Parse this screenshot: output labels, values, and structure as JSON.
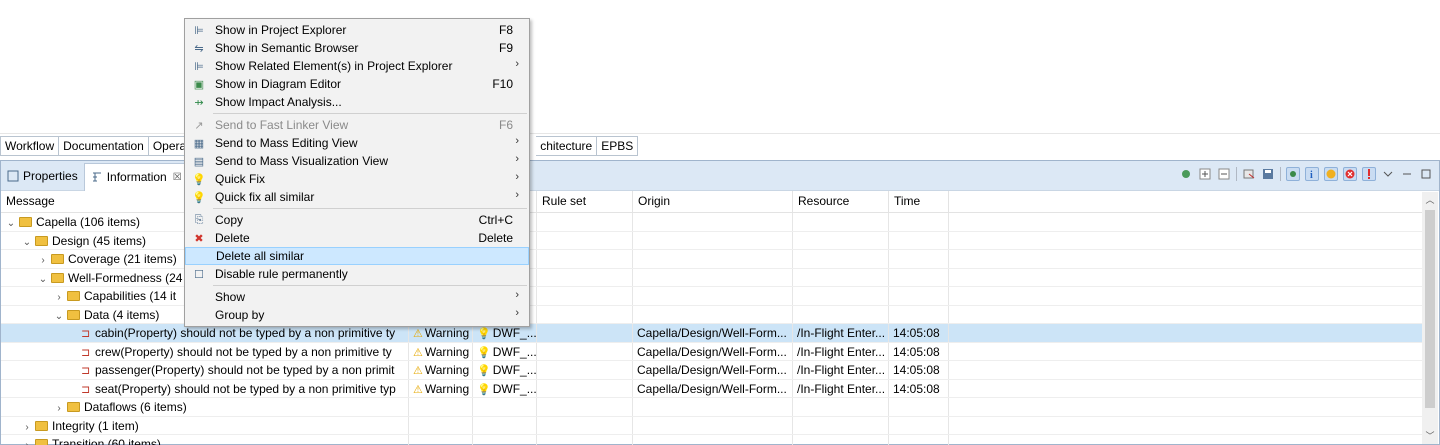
{
  "tabbar": {
    "tabs": [
      "Workflow",
      "Documentation",
      "Opera",
      "chitecture",
      "EPBS"
    ]
  },
  "view": {
    "tabs": [
      {
        "label": "Properties"
      },
      {
        "label": "Information"
      }
    ],
    "close_glyph": "☒"
  },
  "table": {
    "headers": [
      "Message",
      "",
      "",
      "Rule set",
      "Origin",
      "Resource",
      "Time"
    ],
    "rows": [
      {
        "indent": 0,
        "twisty": "v",
        "kind": "folder",
        "message": "Capella (106 items)"
      },
      {
        "indent": 1,
        "twisty": "v",
        "kind": "folder",
        "message": "Design (45 items)"
      },
      {
        "indent": 2,
        "twisty": ">",
        "kind": "folder",
        "message": "Coverage (21 items)"
      },
      {
        "indent": 2,
        "twisty": "v",
        "kind": "folder",
        "message": "Well-Formedness (24"
      },
      {
        "indent": 3,
        "twisty": ">",
        "kind": "folder",
        "message": "Capabilities (14 it"
      },
      {
        "indent": 3,
        "twisty": "v",
        "kind": "folder",
        "message": "Data (4 items)"
      },
      {
        "indent": 4,
        "twisty": "",
        "kind": "leaf",
        "selected": true,
        "message": "cabin(Property) should not be typed by a non primitive ty",
        "severity": "Warning",
        "rule": "DWF_...",
        "origin": "Capella/Design/Well-Form...",
        "resource": "/In-Flight Enter...",
        "time": "14:05:08"
      },
      {
        "indent": 4,
        "twisty": "",
        "kind": "leaf",
        "message": "crew(Property) should not be typed by a non primitive ty",
        "severity": "Warning",
        "rule": "DWF_...",
        "origin": "Capella/Design/Well-Form...",
        "resource": "/In-Flight Enter...",
        "time": "14:05:08"
      },
      {
        "indent": 4,
        "twisty": "",
        "kind": "leaf",
        "message": "passenger(Property) should not be typed by a non primit",
        "severity": "Warning",
        "rule": "DWF_...",
        "origin": "Capella/Design/Well-Form...",
        "resource": "/In-Flight Enter...",
        "time": "14:05:08"
      },
      {
        "indent": 4,
        "twisty": "",
        "kind": "leaf",
        "message": "seat(Property) should not be typed by a non primitive typ",
        "severity": "Warning",
        "rule": "DWF_...",
        "origin": "Capella/Design/Well-Form...",
        "resource": "/In-Flight Enter...",
        "time": "14:05:08"
      },
      {
        "indent": 3,
        "twisty": ">",
        "kind": "folder",
        "message": "Dataflows (6 items)"
      },
      {
        "indent": 1,
        "twisty": ">",
        "kind": "folder",
        "message": "Integrity (1 item)"
      },
      {
        "indent": 1,
        "twisty": ">",
        "kind": "folder",
        "message": "Transition (60 items)"
      }
    ]
  },
  "menu": {
    "items": [
      {
        "type": "item",
        "icon": "project-explorer-icon",
        "glyph": "⊫",
        "label": "Show in Project Explorer",
        "accel": "F8"
      },
      {
        "type": "item",
        "icon": "semantic-browser-icon",
        "glyph": "⇋",
        "label": "Show in Semantic Browser",
        "accel": "F9"
      },
      {
        "type": "item",
        "icon": "project-explorer-icon",
        "glyph": "⊫",
        "label": "Show Related Element(s) in Project Explorer",
        "accel": "",
        "submenu": true
      },
      {
        "type": "item",
        "icon": "diagram-editor-icon",
        "glyph": "▣",
        "label": "Show in Diagram Editor",
        "accel": "F10"
      },
      {
        "type": "item",
        "icon": "impact-analysis-icon",
        "glyph": "⇸",
        "label": "Show Impact Analysis...",
        "accel": ""
      },
      {
        "type": "sep"
      },
      {
        "type": "item",
        "icon": "fast-linker-icon",
        "glyph": "↗",
        "label": "Send to Fast Linker View",
        "accel": "F6",
        "disabled": true
      },
      {
        "type": "item",
        "icon": "mass-editing-icon",
        "glyph": "▦",
        "label": "Send to Mass Editing View",
        "accel": "",
        "submenu": true
      },
      {
        "type": "item",
        "icon": "mass-visualization-icon",
        "glyph": "▤",
        "label": "Send to Mass Visualization View",
        "accel": "",
        "submenu": true
      },
      {
        "type": "item",
        "icon": "lightbulb-icon",
        "glyph": "💡",
        "label": "Quick Fix",
        "accel": "",
        "submenu": true
      },
      {
        "type": "item",
        "icon": "quick-fix-all-icon",
        "glyph": "💡",
        "label": "Quick fix all similar",
        "accel": "",
        "submenu": true
      },
      {
        "type": "sep"
      },
      {
        "type": "item",
        "icon": "copy-icon",
        "glyph": "⎘",
        "label": "Copy",
        "accel": "Ctrl+C"
      },
      {
        "type": "item",
        "icon": "delete-icon",
        "glyph": "✖",
        "label": "Delete",
        "accel": "Delete"
      },
      {
        "type": "item",
        "icon": "",
        "glyph": "",
        "label": "Delete all similar",
        "accel": "",
        "highlighted": true
      },
      {
        "type": "item",
        "icon": "checkbox-icon",
        "glyph": "☐",
        "label": "Disable rule permanently",
        "accel": ""
      },
      {
        "type": "sep"
      },
      {
        "type": "item",
        "icon": "",
        "glyph": "",
        "label": "Show",
        "accel": "",
        "submenu": true
      },
      {
        "type": "item",
        "icon": "",
        "glyph": "",
        "label": "Group by",
        "accel": "",
        "submenu": true
      }
    ]
  },
  "colors": {
    "selection": "#cce4f7",
    "menu_highlight": "#cde8ff",
    "warning": "#e6a800",
    "delete_red": "#d0342c",
    "view_header": "#dce8f5"
  }
}
